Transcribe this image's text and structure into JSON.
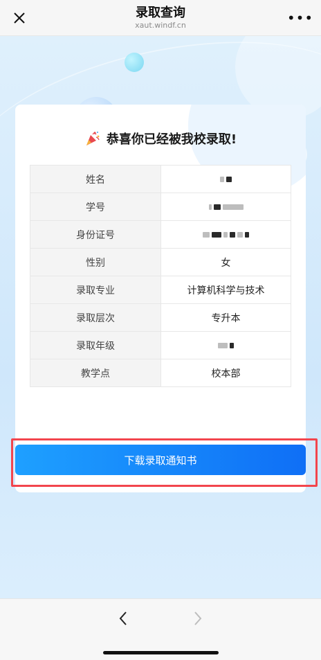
{
  "topbar": {
    "title": "录取查询",
    "subtitle": "xaut.windf.cn",
    "more_label": "•••"
  },
  "card": {
    "heading": "恭喜你已经被我校录取!",
    "rows": [
      {
        "label": "姓名",
        "value": "",
        "redacted": true
      },
      {
        "label": "学号",
        "value": "",
        "redacted": true
      },
      {
        "label": "身份证号",
        "value": "",
        "redacted": true
      },
      {
        "label": "性别",
        "value": "女"
      },
      {
        "label": "录取专业",
        "value": "计算机科学与技术"
      },
      {
        "label": "录取层次",
        "value": "专升本"
      },
      {
        "label": "录取年级",
        "value": "",
        "redacted": true
      },
      {
        "label": "教学点",
        "value": "校本部"
      }
    ],
    "download_label": "下载录取通知书"
  },
  "colors": {
    "button_start": "#1ea0ff",
    "button_end": "#0f6ff6",
    "highlight": "#f2454d",
    "background": "#d9edfc"
  },
  "icons": {
    "close": "close-icon",
    "more": "more-icon",
    "party": "party-popper-icon",
    "back": "chevron-left-icon",
    "forward": "chevron-right-icon"
  }
}
